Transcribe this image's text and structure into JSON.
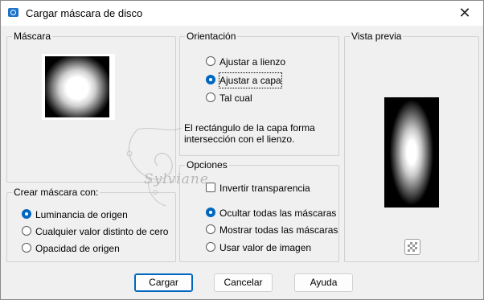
{
  "window": {
    "title": "Cargar máscara de disco",
    "app_icon": "paint-shop-icon",
    "close_icon": "close-icon",
    "close_glyph": "✕"
  },
  "mask_group": {
    "label": "Máscara"
  },
  "create_group": {
    "label": "Crear máscara con:",
    "options": [
      {
        "label": "Luminancia de origen",
        "selected": true
      },
      {
        "label": "Cualquier valor distinto de cero",
        "selected": false
      },
      {
        "label": "Opacidad de origen",
        "selected": false
      }
    ]
  },
  "orientation_group": {
    "label": "Orientación",
    "options": [
      {
        "label": "Ajustar a lienzo",
        "selected": false
      },
      {
        "label": "Ajustar a capa",
        "selected": true
      },
      {
        "label": "Tal cual",
        "selected": false
      }
    ],
    "info": "El rectángulo de la capa forma intersección con el lienzo."
  },
  "options_group": {
    "label": "Opciones",
    "invert": {
      "label": "Invertir transparencia",
      "checked": false
    },
    "options": [
      {
        "label": "Ocultar todas las máscaras",
        "selected": true
      },
      {
        "label": "Mostrar todas las máscaras",
        "selected": false
      },
      {
        "label": "Usar valor de imagen",
        "selected": false
      }
    ]
  },
  "preview_group": {
    "label": "Vista previa",
    "transparency_icon": "checkerboard-icon"
  },
  "buttons": {
    "load": "Cargar",
    "cancel": "Cancelar",
    "help": "Ayuda"
  },
  "watermark": {
    "text": "Sylviane"
  },
  "colors": {
    "accent": "#0067c0",
    "window_bg": "#f0f0f0",
    "titlebar_bg": "#ffffff"
  }
}
